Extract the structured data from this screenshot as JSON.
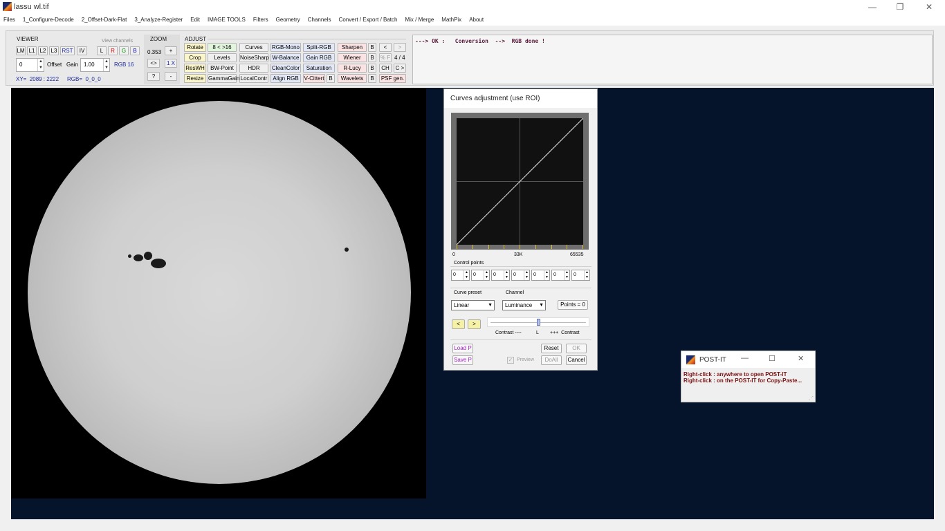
{
  "window": {
    "title": "lassu wl.tif",
    "minimize": "—",
    "restore": "❐",
    "close": "✕"
  },
  "menu": [
    "Files",
    "1_Configure-Decode",
    "2_Offset-Dark-Flat",
    "3_Analyze-Register",
    "Edit",
    "IMAGE TOOLS",
    "Filters",
    "Geometry",
    "Channels",
    "Convert / Export / Batch",
    "Mix / Merge",
    "MathPix",
    "About"
  ],
  "viewer": {
    "label": "VIEWER",
    "view_channels_label": "View channels",
    "buttons": [
      "LM",
      "L1",
      "L2",
      "L3",
      "RST",
      "IV"
    ],
    "channels": [
      "L",
      "R",
      "G",
      "B"
    ],
    "offset_value": "0",
    "offset_label": "Offset",
    "gain_label": "Gain",
    "gain_value": "1.00",
    "bit_depth": "RGB 16",
    "xy_readout": "XY=  2089 : 2222",
    "rgb_readout": "RGB=  0_0_0"
  },
  "zoom": {
    "label": "ZOOM",
    "value": "0.353",
    "plus": "+",
    "fit": "<>",
    "one_x": "1 X",
    "help": "?",
    "minus": "-"
  },
  "adjust": {
    "label": "ADJUST",
    "col1": [
      "Rotate",
      "Crop",
      "ResWH",
      "Resize"
    ],
    "col2": [
      "8 < >16",
      "Levels",
      "BW-Point",
      "GammaGain"
    ],
    "col3": [
      "Curves",
      "NoiseSharp",
      "HDR",
      "LocalContr"
    ],
    "col4": [
      "RGB-Mono",
      "W-Balance",
      "CleanColor",
      "Align RGB"
    ],
    "col5": [
      "Split-RGB",
      "Gain RGB",
      "Saturation",
      "V-Cittert"
    ],
    "col5_b": "B",
    "col6": [
      "Sharpen",
      "Wiener",
      "R-Lucy",
      "Wavelets"
    ],
    "b_label": "B",
    "prev": "<",
    "next": ">",
    "percent_f": "% F",
    "page": "4 / 4",
    "ch": "CH",
    "c_next": "C >",
    "psf": "PSF gen."
  },
  "status": {
    "text": "---> OK :   Conversion  -->  RGB done !"
  },
  "curves": {
    "title": "Curves adjustment   (use ROI)",
    "axis_min": "0",
    "axis_mid": "33K",
    "axis_max": "65535",
    "control_points_label": "Control points",
    "control_values": [
      "0",
      "0",
      "0",
      "0",
      "0",
      "0",
      "0"
    ],
    "curve_preset_label": "Curve preset",
    "channel_label": "Channel",
    "preset_value": "Linear",
    "channel_value": "Luminance",
    "points_button": "Points = 0",
    "prev": "<",
    "next": ">",
    "contrast_minus": "Contrast ----",
    "slider_mark": "L",
    "contrast_plus": "+++  Contrast",
    "load": "Load P",
    "save": "Save P",
    "reset": "Reset",
    "ok": "OK",
    "preview": "Preview",
    "doall": "DoAll",
    "cancel": "Cancel",
    "slider_level": 0.5
  },
  "postit": {
    "title": "POST-IT",
    "line1": "Right-click : anywhere to open POST-IT",
    "line2": "Right-click : on the POST-IT for Copy-Paste..."
  },
  "colors": {
    "image_background": "#05142a",
    "status_text": "#5a1a3a",
    "postit_text": "#7a0f10"
  }
}
